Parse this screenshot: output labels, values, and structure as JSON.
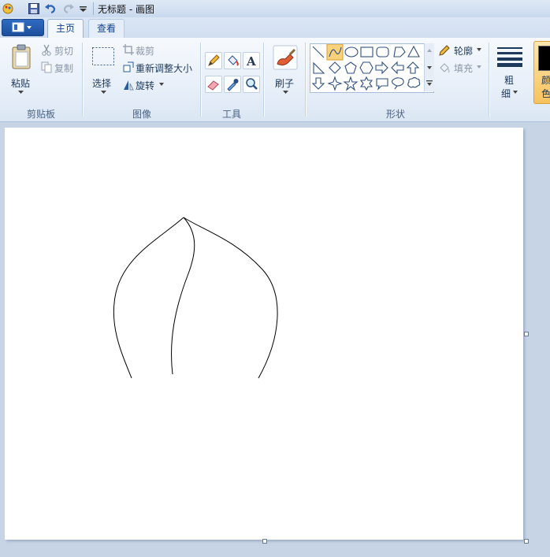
{
  "window": {
    "title": "无标题 - 画图"
  },
  "tabs": [
    {
      "label": "主页"
    },
    {
      "label": "查看"
    }
  ],
  "clipboard": {
    "paste": "粘贴",
    "cut": "剪切",
    "copy": "复制",
    "group": "剪贴板"
  },
  "image": {
    "select": "选择",
    "crop": "裁剪",
    "resize": "重新调整大小",
    "rotate": "旋转",
    "group": "图像"
  },
  "tools": {
    "group": "工具"
  },
  "brushes": {
    "label": "刷子"
  },
  "shapes": {
    "group": "形状",
    "outline": "轮廓",
    "fill": "填充"
  },
  "size": {
    "label_top": "粗",
    "label_bottom": "细"
  },
  "colors": {
    "label_top": "颜",
    "label_bottom": "色",
    "color1": "#000000"
  }
}
